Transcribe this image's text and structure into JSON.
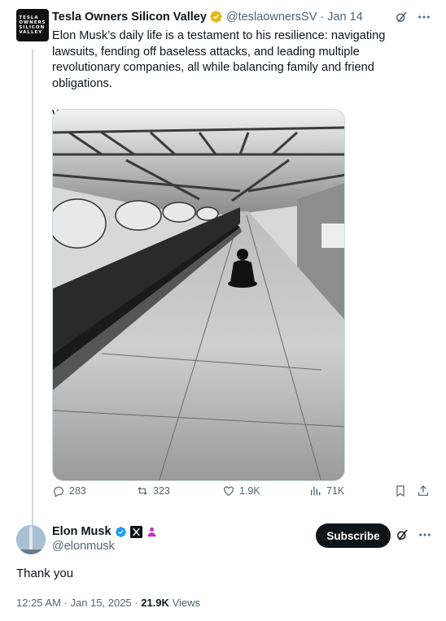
{
  "tweet1": {
    "avatar_text": [
      "TESLA",
      "OWNERS",
      "SILICON",
      "VALLEY"
    ],
    "display_name": "Tesla Owners Silicon Valley",
    "handle": "@teslaownersSV",
    "date": "Jan 14",
    "text_p1": "Elon Musk’s daily life is a testament to his resilience: navigating lawsuits, fending off baseless attacks, and leading multiple revolutionary companies, all while balancing family and friend obligations.",
    "text_p2": "We stand with Elon.",
    "stats": {
      "replies": "283",
      "retweets": "323",
      "likes": "1.9K",
      "views": "71K"
    },
    "verified_color": "#e2b719"
  },
  "tweet2": {
    "display_name": "Elon Musk",
    "handle": "@elonmusk",
    "subscribe_label": "Subscribe",
    "text": "Thank you",
    "time": "12:25 AM · Jan 15, 2025 ·",
    "views_count": "21.9K",
    "views_label": "Views",
    "verified_color": "#1d9bf0",
    "badge_color": "#c72fc8"
  },
  "icons": [
    "grok-icon",
    "more-icon",
    "reply-icon",
    "retweet-icon",
    "like-icon",
    "views-icon",
    "bookmark-icon",
    "share-icon",
    "x-badge-icon"
  ]
}
